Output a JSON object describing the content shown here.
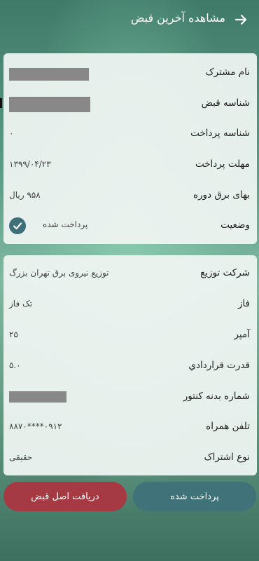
{
  "header": {
    "title": "مشاهده آخرین قبض",
    "back_icon": "arrow-right-icon"
  },
  "bill": {
    "subscriber_name_label": "نام مشترک",
    "bill_id_label": "شناسه قبض",
    "payment_id_label": "شناسه پرداخت",
    "payment_id_value": "۰",
    "due_date_label": "مهلت پرداخت",
    "due_date_value": "۱۳۹۹/۰۴/۲۳",
    "amount_label": "بهای برق دوره",
    "amount_value": "۹۵۸ ریال",
    "status_label": "وضعیت",
    "status_value": "پرداخت شده",
    "status_icon": "check-circle-icon"
  },
  "details": {
    "company_label": "شرکت توزیع",
    "company_value": "توزیع نیروی برق تهران بزرگ",
    "phase_label": "فاز",
    "phase_value": "تک فاز",
    "ampere_label": "آمپر",
    "ampere_value": "۲۵",
    "contract_power_label": "قدرت قراردادي",
    "contract_power_value": "۵.۰",
    "meter_number_label": "شماره بدنه کنتور",
    "phone_label": "تلفن همراه",
    "phone_value": "۰۹۱۲****۸۸۷۰",
    "subscription_type_label": "نوع اشتراک",
    "subscription_type_value": "حقیقی"
  },
  "actions": {
    "paid_label": "پرداخت شده",
    "original_bill_label": "دریافت اصل قبض"
  },
  "colors": {
    "paid_button": "#3f7279",
    "original_button": "#a53a42",
    "status_check": "#3f6f79"
  }
}
